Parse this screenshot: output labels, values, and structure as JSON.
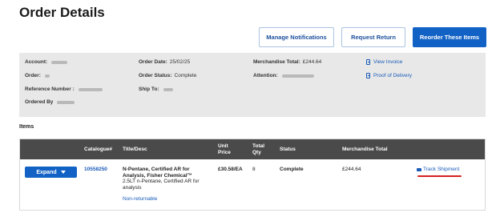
{
  "page": {
    "title": "Order Details"
  },
  "actions": {
    "manage_notifications": "Manage Notifications",
    "request_return": "Request Return",
    "reorder": "Reorder These Items"
  },
  "summary": {
    "account_label": "Account:",
    "order_label": "Order:",
    "reference_label": "Reference Number :",
    "ordered_by_label": "Ordered By",
    "order_date_label": "Order Date:",
    "order_date_value": "25/02/25",
    "order_status_label": "Order Status:",
    "order_status_value": "Complete",
    "ship_to_label": "Ship To:",
    "merch_total_label": "Merchandise Total:",
    "merch_total_value": "£244.64",
    "attention_label": "Attention:",
    "view_invoice": "View Invoice",
    "proof_of_delivery": "Proof of Delivery"
  },
  "items": {
    "heading": "Items",
    "columns": {
      "catalogue": "Catalogue#",
      "title": "Title/Desc",
      "unit_price_1": "Unit",
      "unit_price_2": "Price",
      "total_qty_1": "Total",
      "total_qty_2": "Qty",
      "status": "Status",
      "merch_total": "Merchandise Total"
    },
    "row": {
      "expand_label": "Expand",
      "catalogue": "10558250",
      "title_1": "N-Pentane, Certified AR for",
      "title_2": "Analysis, Fisher Chemical™",
      "desc_1": "2.5LT n-Pentane, Certified AR for",
      "desc_2": "analysis",
      "non_returnable": "Non-returnable",
      "unit_price": "£30.58/EA",
      "qty": "8",
      "status": "Complete",
      "merch_total": "£244.64",
      "track": "Track Shipment"
    }
  }
}
